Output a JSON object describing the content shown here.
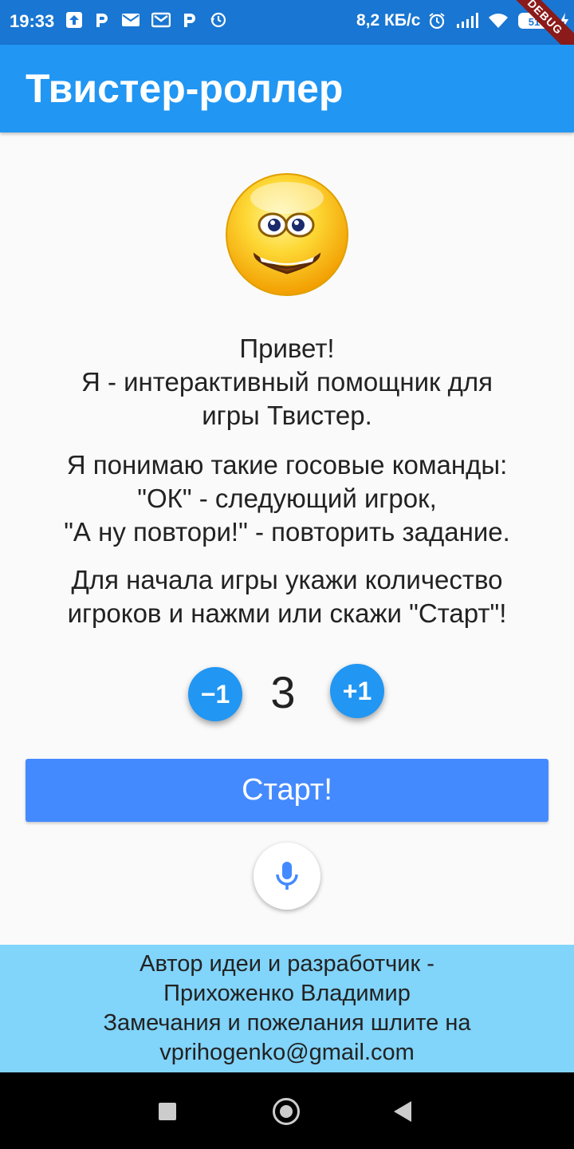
{
  "status_bar": {
    "time": "19:33",
    "speed": "8,2 КБ/с",
    "battery": "51",
    "debug_label": "DEBUG"
  },
  "app_bar": {
    "title": "Твистер-роллер"
  },
  "intro": {
    "greeting": "Привет!",
    "line1": "Я - интерактивный помощник для",
    "line2": "игры Твистер."
  },
  "commands": {
    "line1": "Я понимаю такие госовые команды:",
    "line2": "\"ОК\" - следующий игрок,",
    "line3": "\"А ну повтори!\" - повторить задание."
  },
  "instructions": {
    "line1": "Для начала игры укажи количество",
    "line2": "игроков и нажми или скажи \"Старт\"!"
  },
  "counter": {
    "minus_label": "−1",
    "value": "3",
    "plus_label": "+1"
  },
  "start_label": "Старт!",
  "footer": {
    "line1": "Автор идеи и разработчик -",
    "line2": "Прихоженко Владимир",
    "line3": "Замечания и пожелания шлите на",
    "line4": "vprihogenko@gmail.com"
  },
  "colors": {
    "app_bar": "#2196f3",
    "status_bar": "#1976d2",
    "start_button": "#448aff",
    "footer": "#81d4fa"
  },
  "icons": [
    "upload-icon",
    "p-icon",
    "mail-icon",
    "gmail-icon",
    "history-icon",
    "alarm-icon",
    "signal-icon",
    "wifi-icon",
    "battery-icon",
    "charging-icon",
    "mic-icon",
    "smiley-icon"
  ]
}
